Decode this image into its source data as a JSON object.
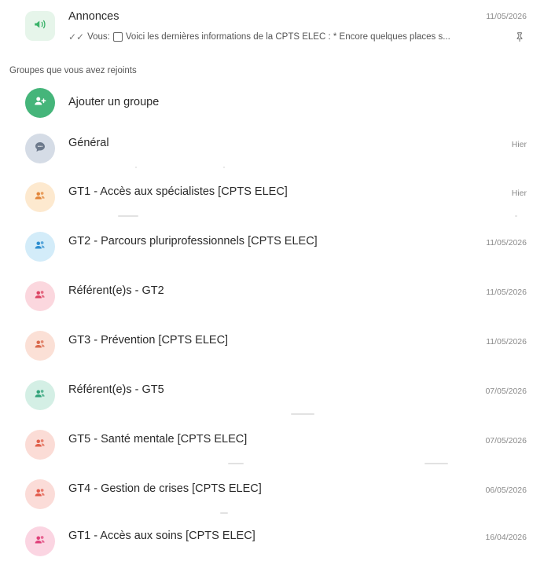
{
  "announcements": {
    "title": "Annonces",
    "date": "11/05/2026",
    "preview_prefix": "Vous:",
    "preview_text": "Voici les dernières informations de la CPTS ELEC : * Encore quelques places s...",
    "icon": "megaphone-icon",
    "accent": "#3bb36a"
  },
  "section": {
    "label": "Groupes que vous avez rejoints"
  },
  "add_group": {
    "label": "Ajouter un groupe",
    "icon": "add-group-icon",
    "color": "#45b57a"
  },
  "groups": [
    {
      "name": "Général",
      "date": "Hier",
      "icon": "chat-bubble-icon",
      "bg": "#d5dce6",
      "fg": "#6d7a8c"
    },
    {
      "name": "GT1 - Accès aux spécialistes [CPTS ELEC]",
      "date": "Hier",
      "icon": "users-icon",
      "bg": "#fde9cf",
      "fg": "#e2863b"
    },
    {
      "name": "GT2 - Parcours pluriprofessionnels [CPTS ELEC]",
      "date": "11/05/2026",
      "icon": "users-icon",
      "bg": "#d3ecf9",
      "fg": "#2f8fd0"
    },
    {
      "name": "Référent(e)s - GT2",
      "date": "11/05/2026",
      "icon": "users-icon",
      "bg": "#fbd7de",
      "fg": "#dc4463"
    },
    {
      "name": "GT3 - Prévention [CPTS ELEC]",
      "date": "11/05/2026",
      "icon": "users-icon",
      "bg": "#fbe0d6",
      "fg": "#d96a4d"
    },
    {
      "name": "Référent(e)s - GT5",
      "date": "07/05/2026",
      "icon": "users-icon",
      "bg": "#d4efe5",
      "fg": "#32a37a"
    },
    {
      "name": "GT5 - Santé mentale [CPTS ELEC]",
      "date": "07/05/2026",
      "icon": "users-icon",
      "bg": "#fbdcd6",
      "fg": "#e0604a"
    },
    {
      "name": "GT4 - Gestion de crises [CPTS ELEC]",
      "date": "06/05/2026",
      "icon": "users-icon",
      "bg": "#fbdcd8",
      "fg": "#e25a4a"
    },
    {
      "name": "GT1 - Accès aux soins [CPTS ELEC]",
      "date": "16/04/2026",
      "icon": "users-icon",
      "bg": "#fbd5e2",
      "fg": "#e0407a"
    }
  ]
}
